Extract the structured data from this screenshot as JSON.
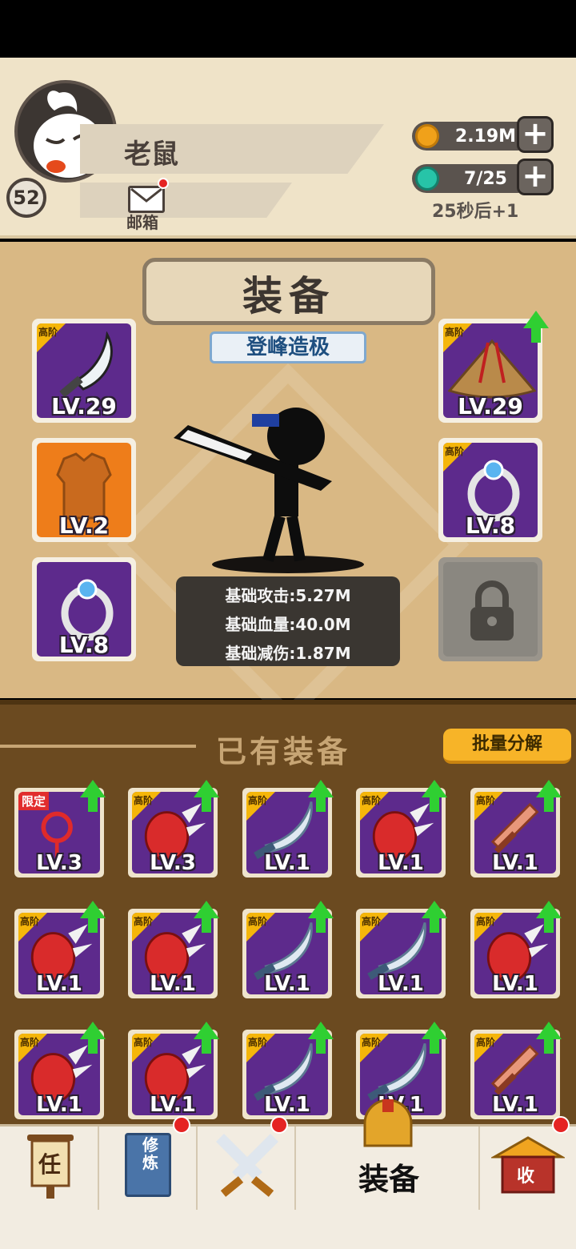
{
  "player": {
    "name": "老鼠",
    "level": "52",
    "mail_label": "邮箱"
  },
  "currency": {
    "gold": "2.19M",
    "gems": "7/25",
    "timer": "25秒后+1"
  },
  "equip_panel": {
    "title": "装备",
    "subtitle": "登峰造极",
    "tier_tag": "高阶",
    "stats": [
      "基础攻击:5.27M",
      "基础血量:40.0M",
      "基础减伤:1.87M"
    ],
    "left_slots": [
      {
        "item": "machete",
        "level": "LV.29",
        "tier": "高阶"
      },
      {
        "item": "armor-vest",
        "level": "LV.2",
        "tier": ""
      },
      {
        "item": "ring",
        "level": "LV.8",
        "tier": ""
      }
    ],
    "right_slots": [
      {
        "item": "straw-hat",
        "level": "LV.29",
        "tier": "高阶",
        "upgrade": true
      },
      {
        "item": "ring",
        "level": "LV.8",
        "tier": "高阶"
      },
      {
        "item": "locked",
        "level": "",
        "tier": ""
      }
    ]
  },
  "inventory": {
    "title": "已有装备",
    "bulk_button": "批量分解",
    "limited_tag": "限定",
    "items": [
      {
        "item": "knot-charm",
        "level": "LV.3",
        "tag": "限定"
      },
      {
        "item": "spiked-gauntlet",
        "level": "LV.3",
        "tag": "高阶"
      },
      {
        "item": "sabre",
        "level": "LV.1",
        "tag": "高阶"
      },
      {
        "item": "spiked-gauntlet",
        "level": "LV.1",
        "tag": "高阶"
      },
      {
        "item": "wooden-sword",
        "level": "LV.1",
        "tag": "高阶"
      },
      {
        "item": "spiked-gauntlet",
        "level": "LV.1",
        "tag": "高阶"
      },
      {
        "item": "spiked-gauntlet",
        "level": "LV.1",
        "tag": "高阶"
      },
      {
        "item": "sabre",
        "level": "LV.1",
        "tag": "高阶"
      },
      {
        "item": "sabre",
        "level": "LV.1",
        "tag": "高阶"
      },
      {
        "item": "spiked-gauntlet",
        "level": "LV.1",
        "tag": "高阶"
      },
      {
        "item": "spiked-gauntlet",
        "level": "LV.1",
        "tag": "高阶"
      },
      {
        "item": "spiked-gauntlet",
        "level": "LV.1",
        "tag": "高阶"
      },
      {
        "item": "sabre",
        "level": "LV.1",
        "tag": "高阶"
      },
      {
        "item": "sabre",
        "level": "LV.1",
        "tag": "高阶"
      },
      {
        "item": "wooden-sword",
        "level": "LV.1",
        "tag": "高阶"
      }
    ]
  },
  "nav": {
    "task_icon_char": "任",
    "cultivate_icon_text": "修炼",
    "equip_label": "装备",
    "collect_icon_char": "收"
  },
  "colors": {
    "panel_bg": "#d9b884",
    "inventory_bg": "#6b4a20",
    "slot_purple": "#5d2a8c",
    "upgrade_green": "#2fcf32",
    "bulk_button": "#f7b428"
  }
}
